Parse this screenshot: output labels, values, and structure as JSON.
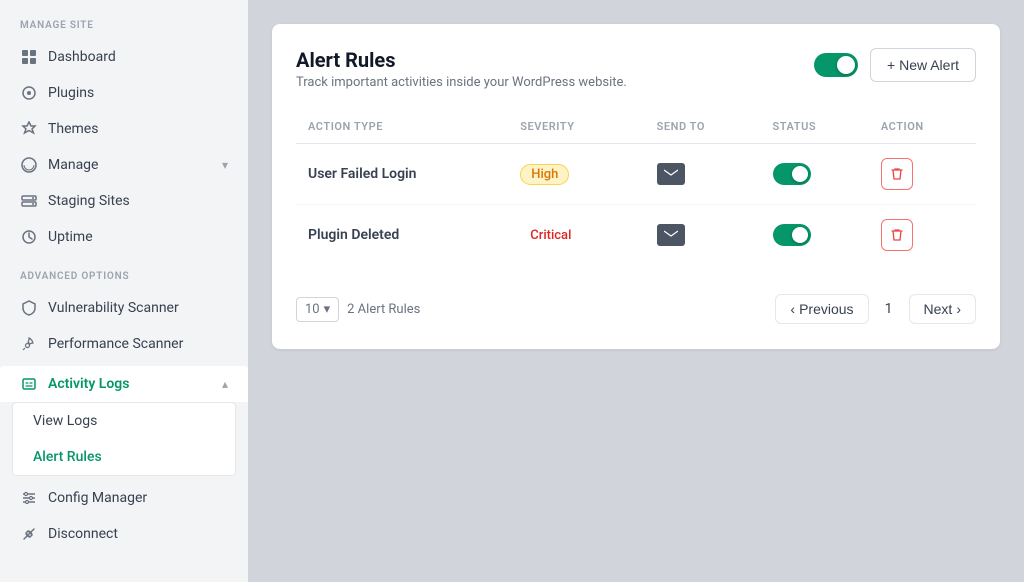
{
  "sidebar": {
    "manage_site_label": "MANAGE SITE",
    "advanced_options_label": "ADVANCED OPTIONS",
    "items": [
      {
        "id": "dashboard",
        "label": "Dashboard",
        "icon": "grid"
      },
      {
        "id": "plugins",
        "label": "Plugins",
        "icon": "gear"
      },
      {
        "id": "themes",
        "label": "Themes",
        "icon": "gear"
      },
      {
        "id": "manage",
        "label": "Manage",
        "icon": "wordpress",
        "has_chevron": true
      },
      {
        "id": "staging-sites",
        "label": "Staging Sites",
        "icon": "server"
      },
      {
        "id": "uptime",
        "label": "Uptime",
        "icon": "circle"
      }
    ],
    "advanced_items": [
      {
        "id": "vulnerability-scanner",
        "label": "Vulnerability Scanner",
        "icon": "shield"
      },
      {
        "id": "performance-scanner",
        "label": "Performance Scanner",
        "icon": "rocket"
      },
      {
        "id": "activity-logs",
        "label": "Activity Logs",
        "icon": "activity",
        "is_open": true,
        "is_active": true
      },
      {
        "id": "config-manager",
        "label": "Config Manager",
        "icon": "sliders"
      },
      {
        "id": "disconnect",
        "label": "Disconnect",
        "icon": "unlink"
      }
    ],
    "submenu": {
      "items": [
        {
          "id": "view-logs",
          "label": "View Logs"
        },
        {
          "id": "alert-rules",
          "label": "Alert Rules",
          "is_active": true
        }
      ]
    }
  },
  "main": {
    "title": "Alert Rules",
    "subtitle": "Track important activities inside your WordPress website.",
    "new_alert_label": "+ New Alert",
    "global_toggle_on": true,
    "table": {
      "columns": [
        {
          "id": "action_type",
          "label": "ACTION TYPE"
        },
        {
          "id": "severity",
          "label": "SEVERITY"
        },
        {
          "id": "send_to",
          "label": "SEND TO"
        },
        {
          "id": "status",
          "label": "STATUS"
        },
        {
          "id": "action",
          "label": "ACTION"
        }
      ],
      "rows": [
        {
          "id": "row-1",
          "action_type": "User Failed Login",
          "severity": "High",
          "severity_style": "high",
          "send_to": "email",
          "status_on": true
        },
        {
          "id": "row-2",
          "action_type": "Plugin Deleted",
          "severity": "Critical",
          "severity_style": "critical",
          "send_to": "email",
          "status_on": true
        }
      ]
    },
    "pagination": {
      "page_size": "10",
      "total_label": "2 Alert Rules",
      "previous_label": "Previous",
      "next_label": "Next",
      "current_page": "1"
    }
  }
}
